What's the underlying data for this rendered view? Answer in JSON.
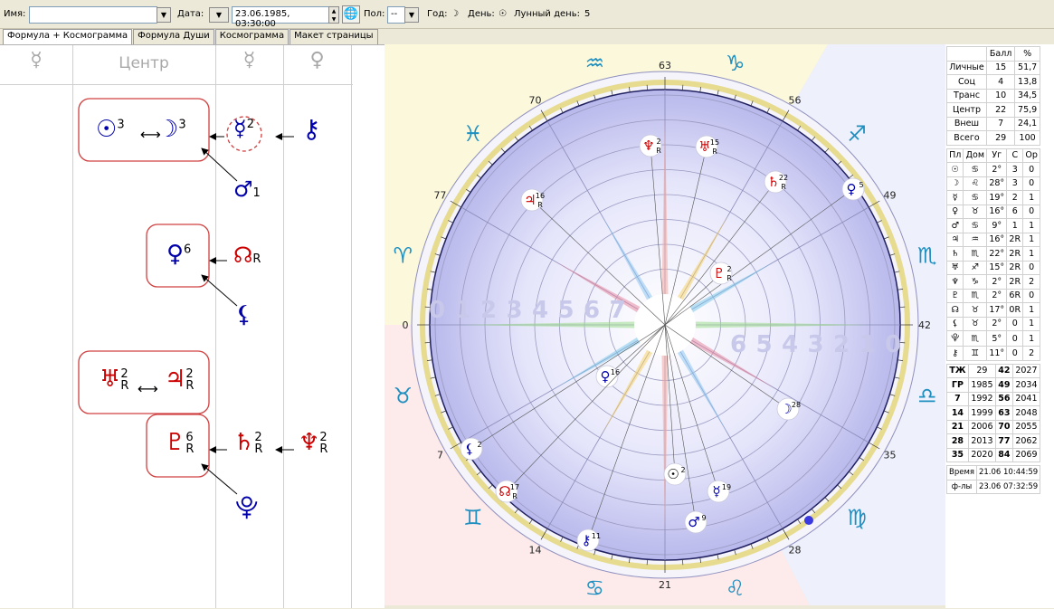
{
  "toolbar": {
    "name_label": "Имя:",
    "name_value": "",
    "date_label": "Дата:",
    "date_value": "23.06.1985, 03:30:00",
    "gender_label": "Пол:",
    "gender_value": "--",
    "year_label": "Год:",
    "year_value": "☽",
    "day_label": "День:",
    "day_value": "☉",
    "lunar_day_label": "Лунный день:",
    "lunar_day_value": "5"
  },
  "tabs": [
    {
      "label": "Формула + Космограмма",
      "active": true
    },
    {
      "label": "Формула Души",
      "active": false
    },
    {
      "label": "Космограмма",
      "active": false
    },
    {
      "label": "Макет страницы",
      "active": false
    }
  ],
  "formula": {
    "headers": [
      "☿",
      "Центр",
      "☿",
      "♀"
    ],
    "nodes": {
      "sun": {
        "glyph": "☉",
        "num": "3"
      },
      "moon": {
        "glyph": "☽",
        "num": "3"
      },
      "mercury": {
        "glyph": "☿",
        "num": "2"
      },
      "chiron": {
        "glyph": "⚷",
        "num": ""
      },
      "mars": {
        "glyph": "♂",
        "num": "1"
      },
      "venus": {
        "glyph": "♀",
        "num": "6"
      },
      "node": {
        "glyph": "☊",
        "num": "R"
      },
      "lilith": {
        "glyph": "⚸",
        "num": ""
      },
      "uranus": {
        "glyph": "♅",
        "num": "2",
        "r": "R"
      },
      "jupiter": {
        "glyph": "♃",
        "num": "2",
        "r": "R"
      },
      "pluto": {
        "glyph": "♇",
        "num": "6",
        "r": "R"
      },
      "saturn": {
        "glyph": "♄",
        "num": "2",
        "r": "R"
      },
      "neptune": {
        "glyph": "♆",
        "num": "2",
        "r": "R"
      },
      "proserpina": {
        "glyph": "⯓",
        "num": ""
      }
    }
  },
  "chart": {
    "degree_marks": [
      "63",
      "56",
      "49",
      "42",
      "35",
      "28",
      "21",
      "14",
      "7",
      "0",
      "77",
      "70"
    ],
    "inner_numbers": [
      "0",
      "1",
      "2",
      "3",
      "4",
      "5",
      "6",
      "7"
    ],
    "signs": [
      "♑",
      "♐",
      "♏",
      "♎",
      "♍",
      "♌",
      "♋",
      "♊",
      "♉",
      "♈",
      "♓",
      "♒"
    ],
    "planets": [
      {
        "glyph": "♆",
        "deg": "2",
        "r": "R",
        "color": "#cc0000"
      },
      {
        "glyph": "♅",
        "deg": "15",
        "r": "R",
        "color": "#cc0000"
      },
      {
        "glyph": "♄",
        "deg": "22",
        "r": "R",
        "color": "#cc0000"
      },
      {
        "glyph": "♀",
        "deg": "5",
        "r": "",
        "color": "#0000aa"
      },
      {
        "glyph": "♃",
        "deg": "16",
        "r": "R",
        "color": "#cc0000"
      },
      {
        "glyph": "♇",
        "deg": "2",
        "r": "R",
        "color": "#cc0000"
      },
      {
        "glyph": "♀",
        "deg": "16",
        "r": "",
        "color": "#0000aa"
      },
      {
        "glyph": "☽",
        "deg": "28",
        "r": "",
        "color": "#0000aa"
      },
      {
        "glyph": "⚸",
        "deg": "2",
        "r": "",
        "color": "#0000aa"
      },
      {
        "glyph": "☊",
        "deg": "17",
        "r": "R",
        "color": "#cc0000"
      },
      {
        "glyph": "☉",
        "deg": "2",
        "r": "",
        "color": "#000000"
      },
      {
        "glyph": "☿",
        "deg": "19",
        "r": "",
        "color": "#0000aa"
      },
      {
        "glyph": "♂",
        "deg": "9",
        "r": "",
        "color": "#0000aa"
      },
      {
        "glyph": "⚷",
        "deg": "11",
        "r": "",
        "color": "#0000aa"
      }
    ]
  },
  "score_table": {
    "headers": [
      "",
      "Балл",
      "%"
    ],
    "rows": [
      [
        "Личные",
        "15",
        "51,7"
      ],
      [
        "Соц",
        "4",
        "13,8"
      ],
      [
        "Транс",
        "10",
        "34,5"
      ],
      [
        "Центр",
        "22",
        "75,9"
      ],
      [
        "Внеш",
        "7",
        "24,1"
      ],
      [
        "Всего",
        "29",
        "100"
      ]
    ]
  },
  "planet_table": {
    "headers": [
      "Пл",
      "Дом",
      "Уг",
      "С",
      "Ор"
    ],
    "rows": [
      [
        "☉",
        "♋",
        "2°",
        "3",
        "0"
      ],
      [
        "☽",
        "♌",
        "28°",
        "3",
        "0"
      ],
      [
        "☿",
        "♋",
        "19°",
        "2",
        "1"
      ],
      [
        "♀",
        "♉",
        "16°",
        "6",
        "0"
      ],
      [
        "♂",
        "♋",
        "9°",
        "1",
        "1"
      ],
      [
        "♃",
        "♒",
        "16°",
        "2R",
        "1"
      ],
      [
        "♄",
        "♏",
        "22°",
        "2R",
        "1"
      ],
      [
        "♅",
        "♐",
        "15°",
        "2R",
        "0"
      ],
      [
        "♆",
        "♑",
        "2°",
        "2R",
        "2"
      ],
      [
        "♇",
        "♏",
        "2°",
        "6R",
        "0"
      ],
      [
        "☊",
        "♉",
        "17°",
        "0R",
        "1"
      ],
      [
        "⚸",
        "♉",
        "2°",
        "0",
        "1"
      ],
      [
        "⯓",
        "♏",
        "5°",
        "0",
        "1"
      ],
      [
        "⚷",
        "♊",
        "11°",
        "0",
        "2"
      ]
    ]
  },
  "years_table": {
    "rows": [
      [
        "ТЖ",
        "29",
        "42",
        "2027"
      ],
      [
        "ГР",
        "1985",
        "49",
        "2034"
      ],
      [
        "7",
        "1992",
        "56",
        "2041"
      ],
      [
        "14",
        "1999",
        "63",
        "2048"
      ],
      [
        "21",
        "2006",
        "70",
        "2055"
      ],
      [
        "28",
        "2013",
        "77",
        "2062"
      ],
      [
        "35",
        "2020",
        "84",
        "2069"
      ]
    ]
  },
  "time_table": {
    "rows": [
      [
        "Время",
        "21.06 10:44:59"
      ],
      [
        "ф-лы",
        "23.06 07:32:59"
      ]
    ]
  },
  "colors": {
    "red": "#cc0000",
    "blue": "#0000aa",
    "box_border": "#d04040"
  }
}
